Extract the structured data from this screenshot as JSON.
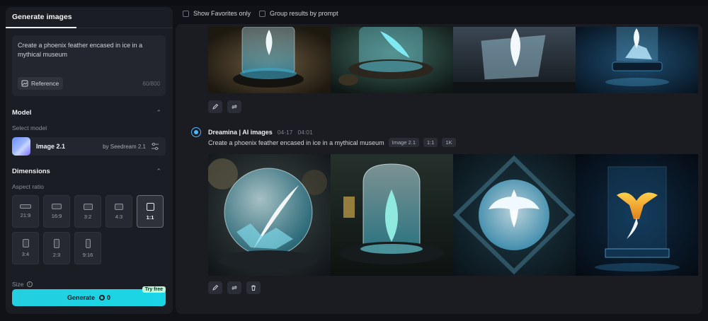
{
  "left_panel": {
    "tab": "Generate images",
    "prompt": "Create a phoenix feather encased in ice in a mythical museum",
    "reference_label": "Reference",
    "char_count": "60/800",
    "model": {
      "section": "Model",
      "select_label": "Select model",
      "name": "Image 2.1",
      "by": "by Seedream 2.1"
    },
    "dimensions": {
      "section": "Dimensions",
      "aspect_label": "Aspect ratio",
      "ratios": [
        "21:9",
        "16:9",
        "3:2",
        "4:3",
        "1:1",
        "3:4",
        "2:3",
        "9:16"
      ],
      "selected": "1:1"
    },
    "size_label": "Size",
    "size_info_icon": "i",
    "generate": {
      "label": "Generate",
      "credits": "0",
      "badge": "Try free"
    }
  },
  "filters": {
    "favorites": "Show Favorites only",
    "group": "Group results by prompt"
  },
  "result": {
    "author": "Dreamina | AI images",
    "date": "04-17",
    "time": "04:01",
    "prompt": "Create a phoenix feather encased in ice in a mythical museum",
    "tags": [
      "Image 2.1",
      "1:1",
      "1K"
    ]
  },
  "colors": {
    "accent": "#1ed3e4",
    "panel": "#1b1d24",
    "background": "#111218"
  },
  "icons": [
    "reference-icon",
    "settings-sliders-icon",
    "chevron-up-icon",
    "info-icon",
    "edit-icon",
    "regenerate-icon",
    "delete-icon",
    "dreamina-logo-icon",
    "credit-icon"
  ]
}
